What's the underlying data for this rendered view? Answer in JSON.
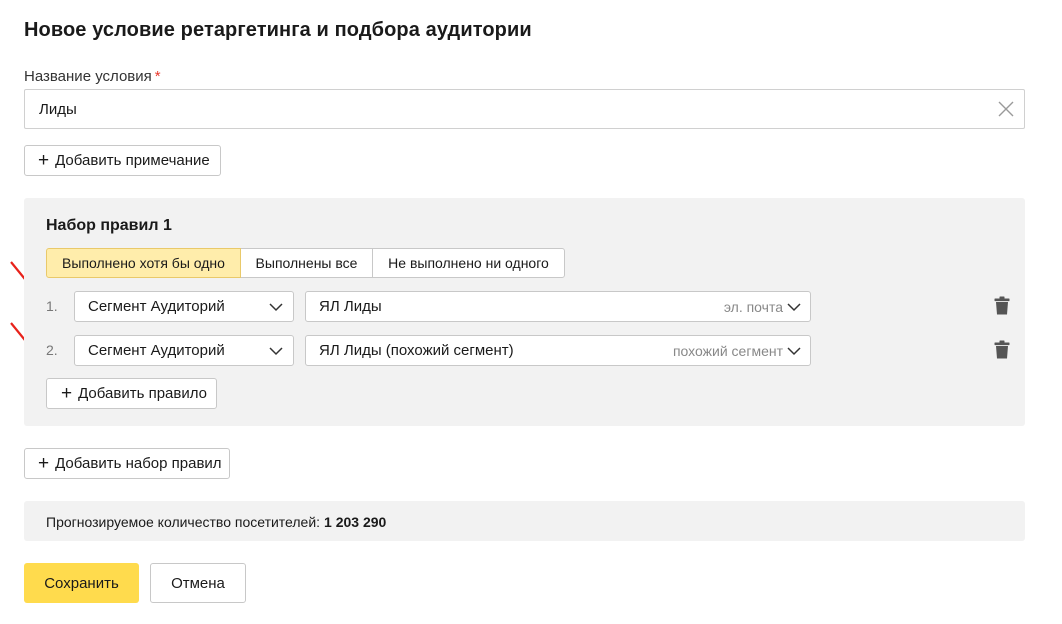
{
  "page": {
    "title": "Новое условие ретаргетинга и подбора аудитории"
  },
  "condition_name": {
    "label": "Название условия",
    "required_mark": "*",
    "value": "Лиды"
  },
  "add_note_button": {
    "label": "Добавить примечание"
  },
  "rule_set": {
    "title": "Набор правил 1",
    "match_modes": [
      {
        "label": "Выполнено хотя бы одно",
        "selected": true
      },
      {
        "label": "Выполнены все",
        "selected": false
      },
      {
        "label": "Не выполнено ни одного",
        "selected": false
      }
    ],
    "rules": [
      {
        "number": "1.",
        "type": "Сегмент Аудиторий",
        "segment": "ЯЛ Лиды",
        "segment_kind": "эл. почта"
      },
      {
        "number": "2.",
        "type": "Сегмент Аудиторий",
        "segment": "ЯЛ Лиды (похожий сегмент)",
        "segment_kind": "похожий сегмент"
      }
    ],
    "add_rule_label": "Добавить правило"
  },
  "add_rule_set_button": {
    "label": "Добавить набор правил"
  },
  "forecast": {
    "label": "Прогнозируемое количество посетителей:",
    "value": "1 203 290"
  },
  "actions": {
    "save_label": "Сохранить",
    "cancel_label": "Отмена"
  },
  "colors": {
    "accent_yellow": "#ffdb4d",
    "active_segment": "#ffedab",
    "panel_bg": "#f2f2f2",
    "required": "#e8372c",
    "annotation_arrow": "#e8221b"
  },
  "icons": {
    "clear": "close-icon",
    "dropdown": "chevron-down-icon",
    "delete": "trash-icon",
    "add": "plus-icon"
  }
}
